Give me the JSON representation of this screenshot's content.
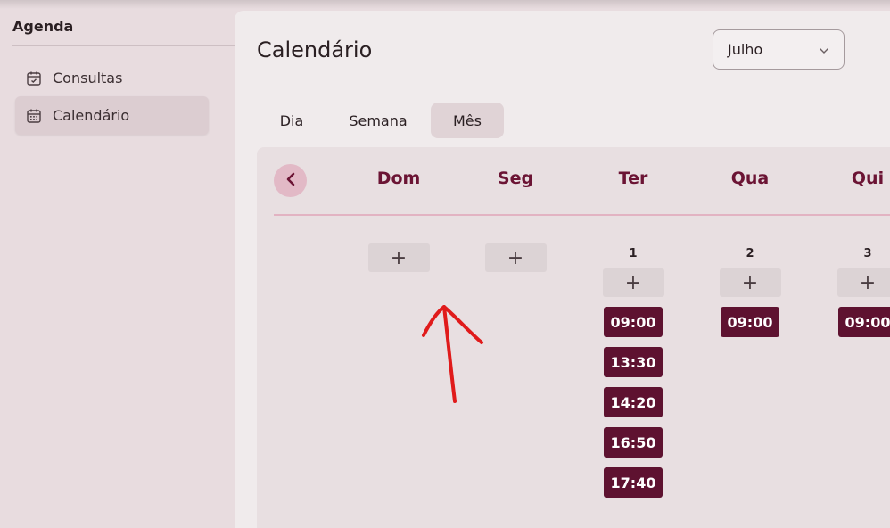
{
  "sidebar": {
    "title": "Agenda",
    "items": [
      {
        "label": "Consultas",
        "icon": "calendar-check-icon"
      },
      {
        "label": "Calendário",
        "icon": "calendar-grid-icon",
        "active": true
      }
    ]
  },
  "header": {
    "title": "Calendário"
  },
  "month_select": {
    "value": "Julho"
  },
  "tabs": [
    {
      "label": "Dia"
    },
    {
      "label": "Semana"
    },
    {
      "label": "Mês",
      "active": true
    }
  ],
  "calendar": {
    "days": [
      "Dom",
      "Seg",
      "Ter",
      "Qua",
      "Qui"
    ],
    "add_label": "+",
    "columns": [
      {
        "day": "",
        "slots": []
      },
      {
        "day": "",
        "slots": []
      },
      {
        "day": "1",
        "slots": [
          "09:00",
          "13:30",
          "14:20",
          "16:50",
          "17:40"
        ]
      },
      {
        "day": "2",
        "slots": [
          "09:00"
        ]
      },
      {
        "day": "3",
        "slots": [
          "09:00"
        ]
      }
    ]
  },
  "colors": {
    "accent": "#6b1434",
    "slot_bg": "#5e1230",
    "annotation": "#e01b1b"
  }
}
